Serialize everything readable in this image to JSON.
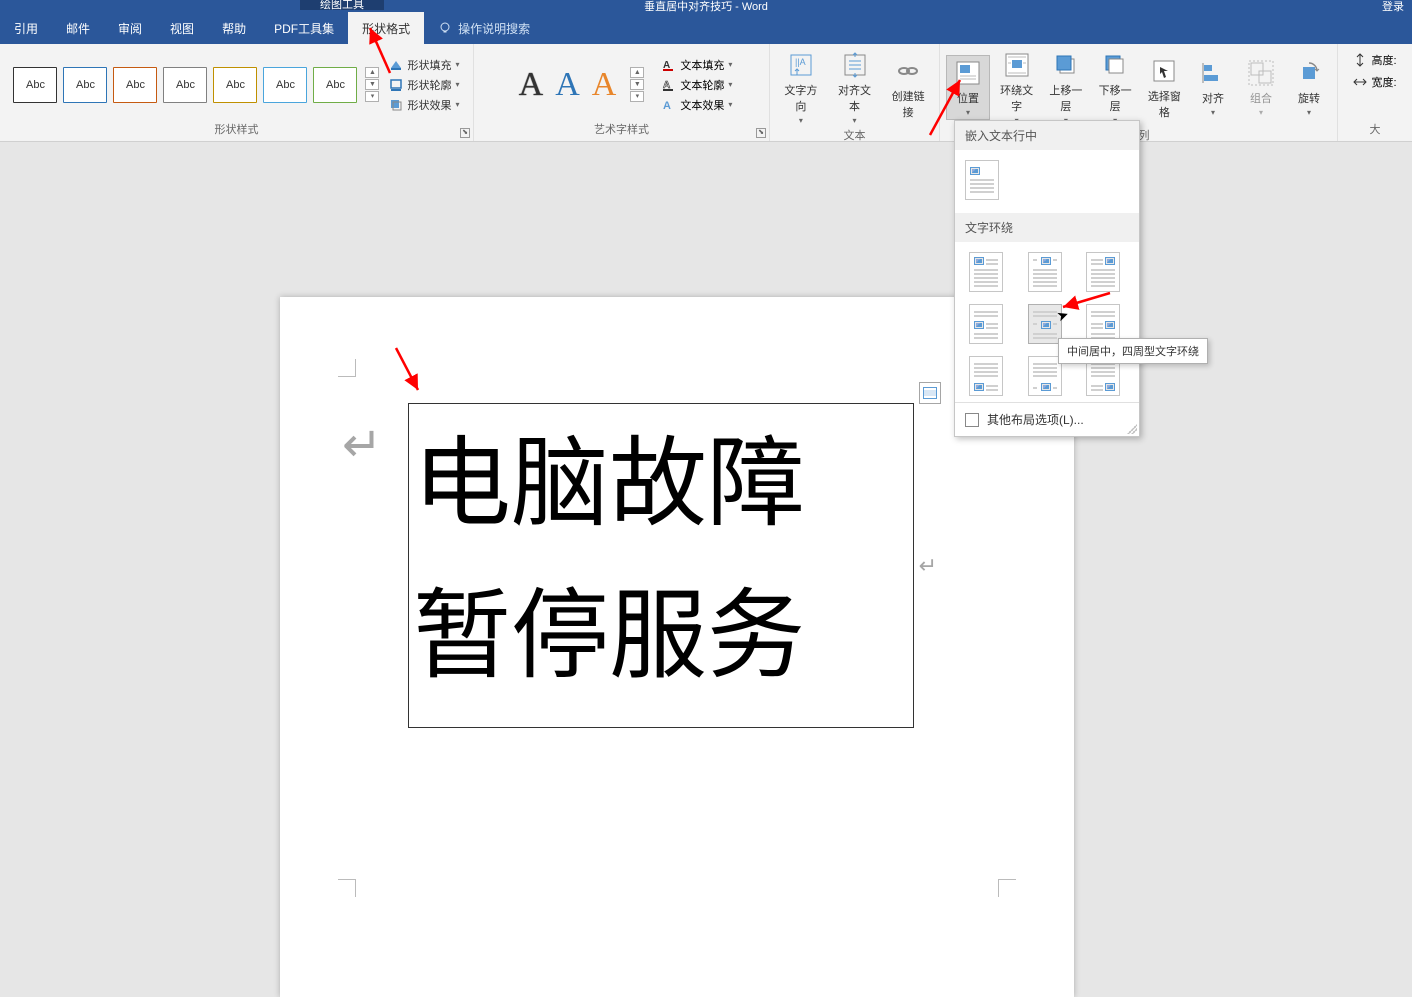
{
  "title_bar": {
    "doc_title": "垂直居中对齐技巧 - Word",
    "drawing_tools": "绘图工具",
    "theme": "登录"
  },
  "tabs": {
    "references": "引用",
    "mailings": "邮件",
    "review": "审阅",
    "view": "视图",
    "help": "帮助",
    "pdf": "PDF工具集",
    "shape_format": "形状格式",
    "tell_me": "操作说明搜索"
  },
  "ribbon": {
    "shape_styles": {
      "swatch_label": "Abc",
      "group_label": "形状样式",
      "fill": "形状填充",
      "outline": "形状轮廓",
      "effects": "形状效果"
    },
    "wordart": {
      "group_label": "艺术字样式",
      "fill": "文本填充",
      "outline": "文本轮廓",
      "effects": "文本效果"
    },
    "text": {
      "direction": "文字方向",
      "align": "对齐文本",
      "link": "创建链接",
      "group_label": "文本"
    },
    "arrange": {
      "position": "位置",
      "wrap": "环绕文字",
      "forward": "上移一层",
      "backward": "下移一层",
      "selection_pane": "选择窗格",
      "align": "对齐",
      "group": "组合",
      "rotate": "旋转",
      "group_label": "排列"
    },
    "size": {
      "height": "高度:",
      "width": "宽度:",
      "group_label": "大"
    }
  },
  "position_panel": {
    "inline_section": "嵌入文本行中",
    "wrap_section": "文字环绕",
    "more_options": "其他布局选项(L)...",
    "tooltip": "中间居中，四周型文字环绕"
  },
  "document": {
    "text_line1": "电脑故障",
    "text_line2": "暂停服务"
  }
}
